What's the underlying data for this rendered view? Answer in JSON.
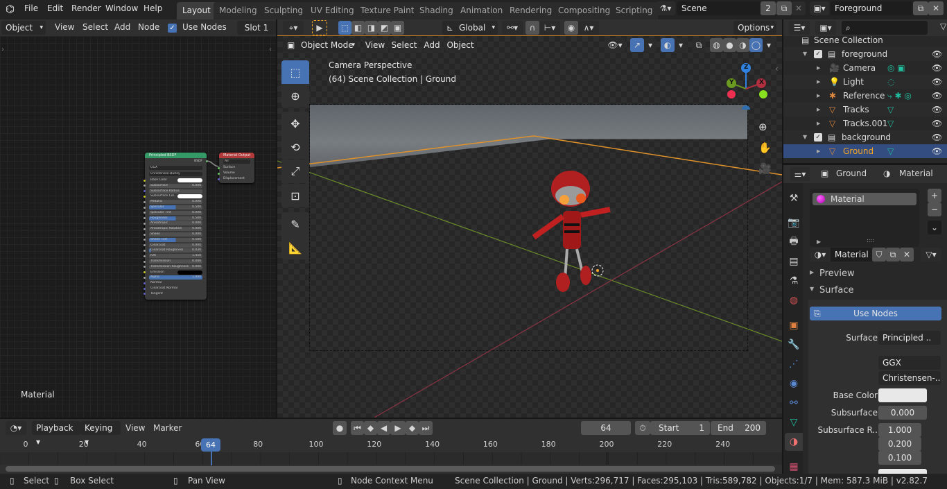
{
  "topbar": {
    "menus": [
      "File",
      "Edit",
      "Render",
      "Window",
      "Help"
    ],
    "workspaces": [
      "Layout",
      "Modeling",
      "Sculpting",
      "UV Editing",
      "Texture Paint",
      "Shading",
      "Animation",
      "Rendering",
      "Compositing",
      "Scripting"
    ],
    "active_workspace": "Layout",
    "scene": {
      "name": "Scene",
      "users": "2"
    },
    "view_layer": "Foreground"
  },
  "node_editor": {
    "object_select": "Object",
    "menus": [
      "View",
      "Select",
      "Add",
      "Node"
    ],
    "use_nodes_label": "Use Nodes",
    "use_nodes_checked": true,
    "slot": "Slot 1",
    "footer_label": "Material",
    "bsdf_node": {
      "title": "Principled BSDF",
      "output": "BSDF",
      "distribution": "GGX",
      "subsurface_method": "Christensen-Burley",
      "inputs": [
        {
          "name": "Base Color",
          "type": "color",
          "value": "#ffffff",
          "socket": "#c7c729"
        },
        {
          "name": "Subsurface",
          "value": "0.000",
          "fill": 0,
          "socket": "#a1a1a1"
        },
        {
          "name": "Subsurface Radius",
          "type": "menu",
          "socket": "#6363c7"
        },
        {
          "name": "Subsurface Col..",
          "type": "color",
          "value": "#ffffff",
          "socket": "#c7c729"
        },
        {
          "name": "Metallic",
          "value": "0.000",
          "fill": 0,
          "socket": "#a1a1a1"
        },
        {
          "name": "Specular",
          "value": "0.500",
          "fill": 0.5,
          "socket": "#a1a1a1"
        },
        {
          "name": "Specular Tint",
          "value": "0.000",
          "fill": 0,
          "socket": "#a1a1a1"
        },
        {
          "name": "Roughness",
          "value": "0.500",
          "fill": 0.5,
          "socket": "#a1a1a1"
        },
        {
          "name": "Anisotropic",
          "value": "0.000",
          "fill": 0,
          "socket": "#a1a1a1"
        },
        {
          "name": "Anisotropic Rotation",
          "value": "0.000",
          "fill": 0,
          "socket": "#a1a1a1"
        },
        {
          "name": "Sheen",
          "value": "0.000",
          "fill": 0,
          "socket": "#a1a1a1"
        },
        {
          "name": "Sheen Tint",
          "value": "0.500",
          "fill": 0.5,
          "socket": "#a1a1a1"
        },
        {
          "name": "Clearcoat",
          "value": "0.000",
          "fill": 0,
          "socket": "#a1a1a1"
        },
        {
          "name": "Clearcoat Roughness",
          "value": "0.030",
          "fill": 0.03,
          "socket": "#a1a1a1"
        },
        {
          "name": "IOR",
          "value": "1.450",
          "fill": 0,
          "socket": "#a1a1a1"
        },
        {
          "name": "Transmission",
          "value": "0.000",
          "fill": 0,
          "socket": "#a1a1a1"
        },
        {
          "name": "Transmission Roughness",
          "value": "0.000",
          "fill": 0,
          "socket": "#a1a1a1"
        },
        {
          "name": "Emission",
          "type": "color",
          "value": "#000000",
          "socket": "#c7c729"
        },
        {
          "name": "Alpha",
          "value": "1.000",
          "fill": 1,
          "socket": "#a1a1a1"
        },
        {
          "name": "Normal",
          "type": "plain",
          "socket": "#6363c7"
        },
        {
          "name": "Clearcoat Normal",
          "type": "plain",
          "socket": "#6363c7"
        },
        {
          "name": "Tangent",
          "type": "plain",
          "socket": "#6363c7"
        }
      ]
    },
    "output_node": {
      "title": "Material Output",
      "target": "All",
      "inputs": [
        "Surface",
        "Volume",
        "Displacement"
      ]
    }
  },
  "viewport": {
    "transform_orientation": "Global",
    "options_label": "Options",
    "mode": "Object Mode",
    "menus": [
      "View",
      "Select",
      "Add",
      "Object"
    ],
    "overlay_title": "Camera Perspective",
    "overlay_subtitle": "(64) Scene Collection | Ground",
    "gizmo": {
      "z": "Z",
      "y": "Y",
      "x": "X"
    }
  },
  "outliner": {
    "root": "Scene Collection",
    "items": [
      {
        "name": "foreground",
        "kind": "collection",
        "indent": 0
      },
      {
        "name": "Camera",
        "kind": "camera",
        "indent": 1
      },
      {
        "name": "Light",
        "kind": "light",
        "indent": 1
      },
      {
        "name": "Reference",
        "kind": "armature",
        "indent": 1
      },
      {
        "name": "Tracks",
        "kind": "mesh",
        "indent": 1
      },
      {
        "name": "Tracks.001",
        "kind": "mesh",
        "indent": 1
      },
      {
        "name": "background",
        "kind": "collection",
        "indent": 0
      },
      {
        "name": "Ground",
        "kind": "mesh",
        "indent": 1,
        "selected": true
      }
    ]
  },
  "properties": {
    "breadcrumb": [
      "Ground",
      "Material"
    ],
    "material_slots": [
      "Material"
    ],
    "material_name": "Material",
    "panels": {
      "preview": "Preview",
      "surface": "Surface"
    },
    "use_nodes_button": "Use Nodes",
    "surface_label": "Surface",
    "surface_value": "Principled ..",
    "distribution": "GGX",
    "subsurface_method": "Christensen-..",
    "base_color_label": "Base Color",
    "base_color": "#e8e8e8",
    "subsurface_label": "Subsurface",
    "subsurface_value": "0.000",
    "subsurface_radius_label": "Subsurface R..",
    "subsurface_radius": [
      "1.000",
      "0.200",
      "0.100"
    ]
  },
  "timeline": {
    "menus": [
      "Playback",
      "Keying",
      "View",
      "Marker"
    ],
    "current_frame": "64",
    "start_label": "Start",
    "start": "1",
    "end_label": "End",
    "end": "200",
    "ticks": [
      "0",
      "20",
      "40",
      "60",
      "80",
      "100",
      "120",
      "140",
      "160",
      "180",
      "200",
      "220",
      "240"
    ]
  },
  "statusbar": {
    "hints": [
      {
        "icon": "mouse-left-icon",
        "label": "Select"
      },
      {
        "icon": "mouse-drag-icon",
        "label": "Box Select"
      },
      {
        "icon": "mouse-middle-icon",
        "label": "Pan View"
      },
      {
        "icon": "mouse-right-icon",
        "label": "Node Context Menu"
      }
    ],
    "stats": "Scene Collection | Ground | Verts:296,717 | Faces:295,103 | Tris:589,782 | Objects:1/7 | Mem: 587.3 MiB | v2.82.7"
  },
  "colors": {
    "accent": "#4772b3",
    "selection_orange": "#f5a623",
    "outliner_selected": "#334d80"
  }
}
